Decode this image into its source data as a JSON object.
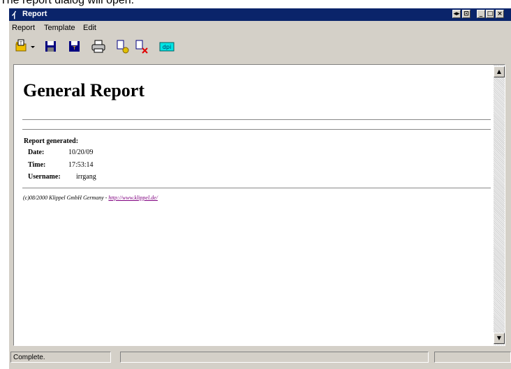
{
  "caption": "The report dialog will open.",
  "window": {
    "title": "Report",
    "title_icon": "klippel-icon",
    "controls": [
      "restore-icon",
      "pin-icon",
      "minimize-icon",
      "maximize-icon",
      "close-icon"
    ]
  },
  "menu": {
    "items": [
      "Report",
      "Template",
      "Edit"
    ]
  },
  "toolbar": {
    "buttons": [
      "open-icon",
      "dropdown-arrow-icon",
      "save-icon",
      "save-as-icon",
      "print-icon",
      "add-page-icon",
      "delete-page-icon",
      "dpi-button"
    ],
    "dpi_label": "dpi"
  },
  "report": {
    "title": "General Report",
    "generated_label": "Report generated:",
    "date_label": "Date:",
    "date_value": "10/20/09",
    "time_label": "Time:",
    "time_value": "17:53:14",
    "username_label": "Username:",
    "username_value": "irrgang",
    "footer_text": "(c)08/2000 Klippel GmbH Germany - ",
    "footer_link": "http://www.klippel.de/"
  },
  "status": {
    "text": "Complete.",
    "pane2": "",
    "pane3": ""
  },
  "colors": {
    "titlebar": "#0a246a",
    "face": "#d4d0c8",
    "link": "#800080",
    "dpi_button": "#00e5e5"
  }
}
